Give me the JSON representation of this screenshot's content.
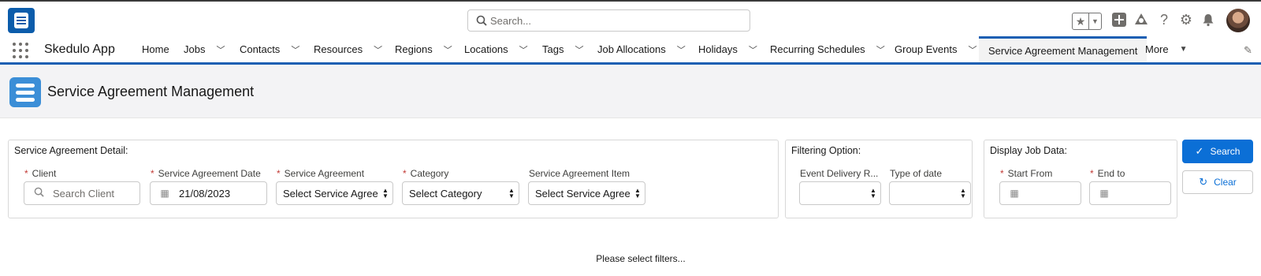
{
  "header": {
    "search_placeholder": "Search...",
    "icons": [
      "star-icon",
      "add-icon",
      "trailhead-icon",
      "help-icon",
      "gear-icon",
      "bell-icon"
    ]
  },
  "nav": {
    "app_name": "Skedulo App",
    "items": [
      {
        "label": "Home",
        "has_menu": false
      },
      {
        "label": "Jobs",
        "has_menu": true
      },
      {
        "label": "Contacts",
        "has_menu": true
      },
      {
        "label": "Resources",
        "has_menu": true
      },
      {
        "label": "Regions",
        "has_menu": true
      },
      {
        "label": "Locations",
        "has_menu": true
      },
      {
        "label": "Tags",
        "has_menu": true
      },
      {
        "label": "Job Allocations",
        "has_menu": true
      },
      {
        "label": "Holidays",
        "has_menu": true
      },
      {
        "label": "Recurring Schedules",
        "has_menu": true
      },
      {
        "label": "Group Events",
        "has_menu": true
      },
      {
        "label": "Service Agreement Management",
        "active": true
      },
      {
        "label": "More",
        "has_menu": true
      }
    ]
  },
  "page": {
    "title": "Service Agreement Management"
  },
  "detail_panel": {
    "title": "Service Agreement Detail:",
    "client": {
      "label": "Client",
      "required": true,
      "placeholder": "Search Client"
    },
    "date": {
      "label": "Service Agreement Date",
      "required": true,
      "value": "21/08/2023"
    },
    "agreement": {
      "label": "Service Agreement",
      "required": true,
      "value": "Select Service Agreement"
    },
    "category": {
      "label": "Category",
      "required": true,
      "value": "Select Category"
    },
    "item": {
      "label": "Service Agreement Item",
      "required": false,
      "value": "Select Service Agreement Item"
    }
  },
  "filter_panel": {
    "title": "Filtering Option:",
    "delivery": {
      "label": "Event Delivery R...",
      "value": ""
    },
    "date_type": {
      "label": "Type of date",
      "value": ""
    }
  },
  "display_panel": {
    "title": "Display Job Data:",
    "start": {
      "label": "Start From",
      "required": true,
      "value": ""
    },
    "end": {
      "label": "End to",
      "required": true,
      "value": ""
    }
  },
  "buttons": {
    "search": "Search",
    "clear": "Clear"
  },
  "message": "Please select filters...",
  "colors": {
    "brand": "#0b5cab",
    "accent": "#0b6fd6",
    "nav_underline": "#1b5fb3",
    "required": "#c23934"
  }
}
